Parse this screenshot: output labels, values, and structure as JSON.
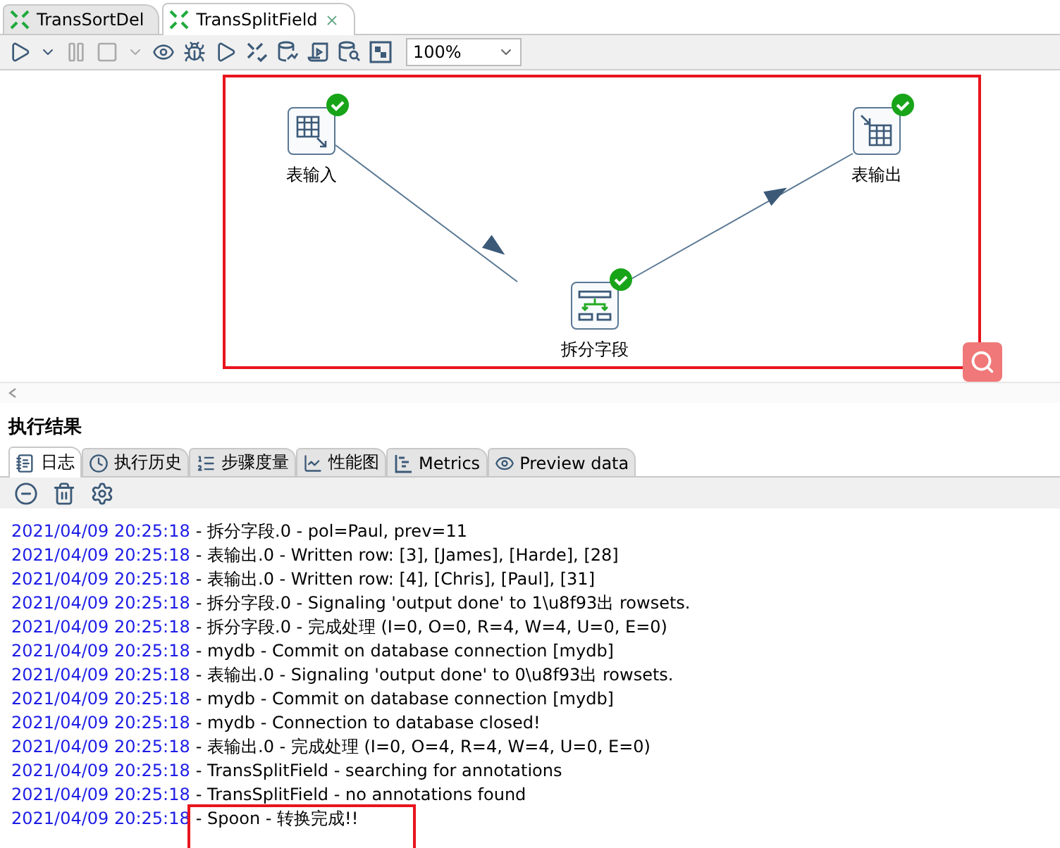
{
  "editor_tabs": [
    {
      "label": "TransSortDel",
      "selected": false
    },
    {
      "label": "TransSplitField",
      "selected": true
    }
  ],
  "toolbar": {
    "zoom": "100%"
  },
  "canvas": {
    "steps": [
      {
        "label": "表输入",
        "kind": "input",
        "ok": true
      },
      {
        "label": "拆分字段",
        "kind": "split",
        "ok": true
      },
      {
        "label": "表输出",
        "kind": "output",
        "ok": true
      }
    ]
  },
  "results": {
    "title": "执行结果",
    "tabs": [
      {
        "label": "日志",
        "kind": "log",
        "selected": true
      },
      {
        "label": "执行历史",
        "kind": "history",
        "selected": false
      },
      {
        "label": "步骤度量",
        "kind": "metrics-list",
        "selected": false
      },
      {
        "label": "性能图",
        "kind": "chart",
        "selected": false
      },
      {
        "label": "Metrics",
        "kind": "gantt",
        "selected": false
      },
      {
        "label": "Preview data",
        "kind": "preview",
        "selected": false
      }
    ],
    "log": [
      {
        "time": "2021/04/09 20:25:18",
        "message": "- 拆分字段.0 - pol=Paul, prev=11"
      },
      {
        "time": "2021/04/09 20:25:18",
        "message": "- 表输出.0 - Written row: [3], [James], [Harde], [28]"
      },
      {
        "time": "2021/04/09 20:25:18",
        "message": "- 表输出.0 - Written row: [4], [Chris], [Paul], [31]"
      },
      {
        "time": "2021/04/09 20:25:18",
        "message": "- 拆分字段.0 - Signaling 'output done' to 1\\u8f93出 rowsets."
      },
      {
        "time": "2021/04/09 20:25:18",
        "message": "- 拆分字段.0 - 完成处理 (I=0, O=0, R=4, W=4, U=0, E=0)"
      },
      {
        "time": "2021/04/09 20:25:18",
        "message": "- mydb - Commit on database connection [mydb]"
      },
      {
        "time": "2021/04/09 20:25:18",
        "message": "- 表输出.0 - Signaling 'output done' to 0\\u8f93出 rowsets."
      },
      {
        "time": "2021/04/09 20:25:18",
        "message": "- mydb - Commit on database connection [mydb]"
      },
      {
        "time": "2021/04/09 20:25:18",
        "message": "- mydb - Connection to database closed!"
      },
      {
        "time": "2021/04/09 20:25:18",
        "message": "- 表输出.0 - 完成处理 (I=0, O=4, R=4, W=4, U=0, E=0)"
      },
      {
        "time": "2021/04/09 20:25:18",
        "message": "- TransSplitField - searching for annotations"
      },
      {
        "time": "2021/04/09 20:25:18",
        "message": "- TransSplitField - no annotations found"
      },
      {
        "time": "2021/04/09 20:25:18",
        "message": "- Spoon - 转换完成!!"
      }
    ]
  }
}
